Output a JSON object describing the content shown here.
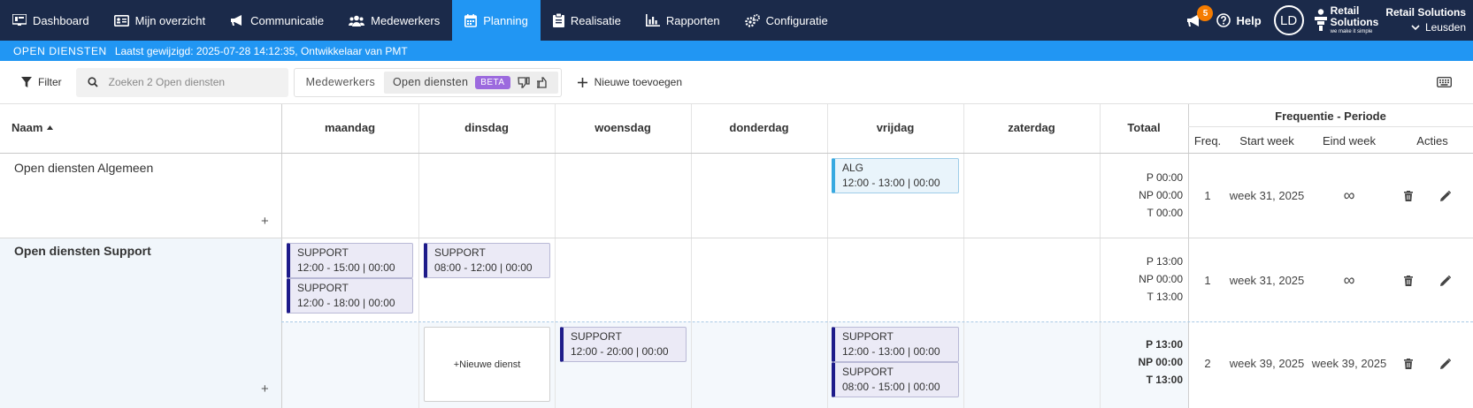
{
  "nav": {
    "items": [
      {
        "label": "Dashboard",
        "icon": "dashboard-icon"
      },
      {
        "label": "Mijn overzicht",
        "icon": "id-card-icon"
      },
      {
        "label": "Communicatie",
        "icon": "megaphone-icon"
      },
      {
        "label": "Medewerkers",
        "icon": "users-icon"
      },
      {
        "label": "Planning",
        "icon": "calendar-icon",
        "active": true
      },
      {
        "label": "Realisatie",
        "icon": "clipboard-icon"
      },
      {
        "label": "Rapporten",
        "icon": "bar-chart-icon"
      },
      {
        "label": "Configuratie",
        "icon": "gears-icon"
      }
    ],
    "notification_count": "5",
    "help_label": "Help",
    "avatar_initials": "LD",
    "logo_line1": "Retail",
    "logo_line2": "Solutions",
    "logo_tagline": "we make it simple",
    "org_name": "Retail Solutions",
    "location": "Leusden"
  },
  "subbar": {
    "title": "OPEN DIENSTEN",
    "last_modified": "Laatst gewijzigd: 2025-07-28 14:12:35, Ontwikkelaar van PMT"
  },
  "toolbar": {
    "filter_label": "Filter",
    "search_placeholder": "Zoeken 2 Open diensten",
    "toggle_employees": "Medewerkers",
    "toggle_open_shifts": "Open diensten",
    "beta_label": "BETA",
    "add_new_label": "Nieuwe toevoegen"
  },
  "grid": {
    "name_header": "Naam",
    "days": [
      "maandag",
      "dinsdag",
      "woensdag",
      "donderdag",
      "vrijdag",
      "zaterdag"
    ],
    "total_header": "Totaal",
    "freq_period_header": "Frequentie - Periode",
    "freq_cols": [
      "Freq.",
      "Start week",
      "Eind week",
      "Acties"
    ],
    "new_shift_label": "+Nieuwe dienst",
    "plus_label": "+",
    "infinity": "∞",
    "rows": [
      {
        "name": "Open diensten Algemeen",
        "shifts": [
          {
            "day": "vrijdag",
            "code": "ALG",
            "time": "12:00 - 13:00 | 00:00"
          }
        ],
        "totals": {
          "p_label": "P",
          "p": "00:00",
          "np_label": "NP",
          "np": "00:00",
          "t_label": "T",
          "t": "00:00"
        },
        "freq": "1",
        "start_week": "week 31, 2025",
        "end_week": ""
      },
      {
        "name": "Open diensten Support",
        "shifts": [
          {
            "day": "maandag",
            "code": "SUPPORT",
            "time": "12:00 - 15:00 | 00:00"
          },
          {
            "day": "maandag",
            "code": "SUPPORT",
            "time": "12:00 - 18:00 | 00:00"
          },
          {
            "day": "dinsdag",
            "code": "SUPPORT",
            "time": "08:00 - 12:00 | 00:00"
          }
        ],
        "totals": {
          "p_label": "P",
          "p": "13:00",
          "np_label": "NP",
          "np": "00:00",
          "t_label": "T",
          "t": "13:00"
        },
        "freq": "1",
        "start_week": "week 31, 2025",
        "end_week": ""
      },
      {
        "name": "",
        "shifts": [
          {
            "day": "woensdag",
            "code": "SUPPORT",
            "time": "12:00 - 20:00 | 00:00"
          },
          {
            "day": "vrijdag",
            "code": "SUPPORT",
            "time": "12:00 - 13:00 | 00:00"
          },
          {
            "day": "vrijdag",
            "code": "SUPPORT",
            "time": "08:00 - 15:00 | 00:00"
          }
        ],
        "totals": {
          "p_label": "P",
          "p": "13:00",
          "np_label": "NP",
          "np": "00:00",
          "t_label": "T",
          "t": "13:00"
        },
        "freq": "2",
        "start_week": "week 39, 2025",
        "end_week": "week 39, 2025"
      }
    ]
  },
  "colors": {
    "nav_bg": "#1b2a4a",
    "accent": "#2196f3",
    "shift_support_border": "#1e1b8a",
    "shift_alg_border": "#38a9e0",
    "badge": "#f57c00",
    "beta": "#9c6ade"
  }
}
